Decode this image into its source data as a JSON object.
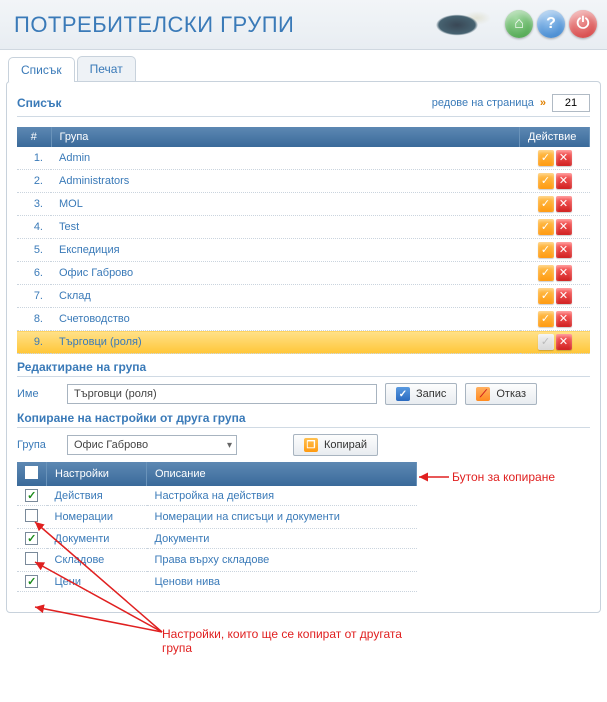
{
  "header": {
    "title": "ПОТРЕБИТЕЛСКИ ГРУПИ"
  },
  "tabs": [
    {
      "label": "Списък",
      "active": true
    },
    {
      "label": "Печат",
      "active": false
    }
  ],
  "list": {
    "heading": "Списък",
    "rows_per_page_label": "редове на страница",
    "rows_per_page_value": "21",
    "columns": {
      "index": "#",
      "group": "Група",
      "action": "Действие"
    },
    "rows": [
      {
        "n": "1.",
        "name": "Admin",
        "selected": false,
        "edit_enabled": true
      },
      {
        "n": "2.",
        "name": "Administrators",
        "selected": false,
        "edit_enabled": true
      },
      {
        "n": "3.",
        "name": "MOL",
        "selected": false,
        "edit_enabled": true
      },
      {
        "n": "4.",
        "name": "Test",
        "selected": false,
        "edit_enabled": true
      },
      {
        "n": "5.",
        "name": "Експедиция",
        "selected": false,
        "edit_enabled": true
      },
      {
        "n": "6.",
        "name": "Офис Габрово",
        "selected": false,
        "edit_enabled": true
      },
      {
        "n": "7.",
        "name": "Склад",
        "selected": false,
        "edit_enabled": true
      },
      {
        "n": "8.",
        "name": "Счетоводство",
        "selected": false,
        "edit_enabled": true
      },
      {
        "n": "9.",
        "name": "Търговци (роля)",
        "selected": true,
        "edit_enabled": false
      }
    ]
  },
  "edit": {
    "heading": "Редактиране на група",
    "name_label": "Име",
    "name_value": "Търговци (роля)",
    "save_label": "Запис",
    "cancel_label": "Отказ"
  },
  "copy": {
    "heading": "Копиране на настройки от друга група",
    "group_label": "Група",
    "selected_group": "Офис Габрово",
    "copy_label": "Копирай",
    "columns": {
      "settings": "Настройки",
      "description": "Описание"
    },
    "rows": [
      {
        "checked": true,
        "name": "Действия",
        "desc": "Настройка на действия"
      },
      {
        "checked": false,
        "name": "Номерации",
        "desc": "Номерации на списъци и документи"
      },
      {
        "checked": true,
        "name": "Документи",
        "desc": "Документи"
      },
      {
        "checked": false,
        "name": "Складове",
        "desc": "Права върху складове"
      },
      {
        "checked": true,
        "name": "Цени",
        "desc": "Ценови нива"
      }
    ]
  },
  "annotations": {
    "copy_btn": "Бутон за копиране",
    "settings_note": "Настройки, които ще се копират от другата група"
  }
}
